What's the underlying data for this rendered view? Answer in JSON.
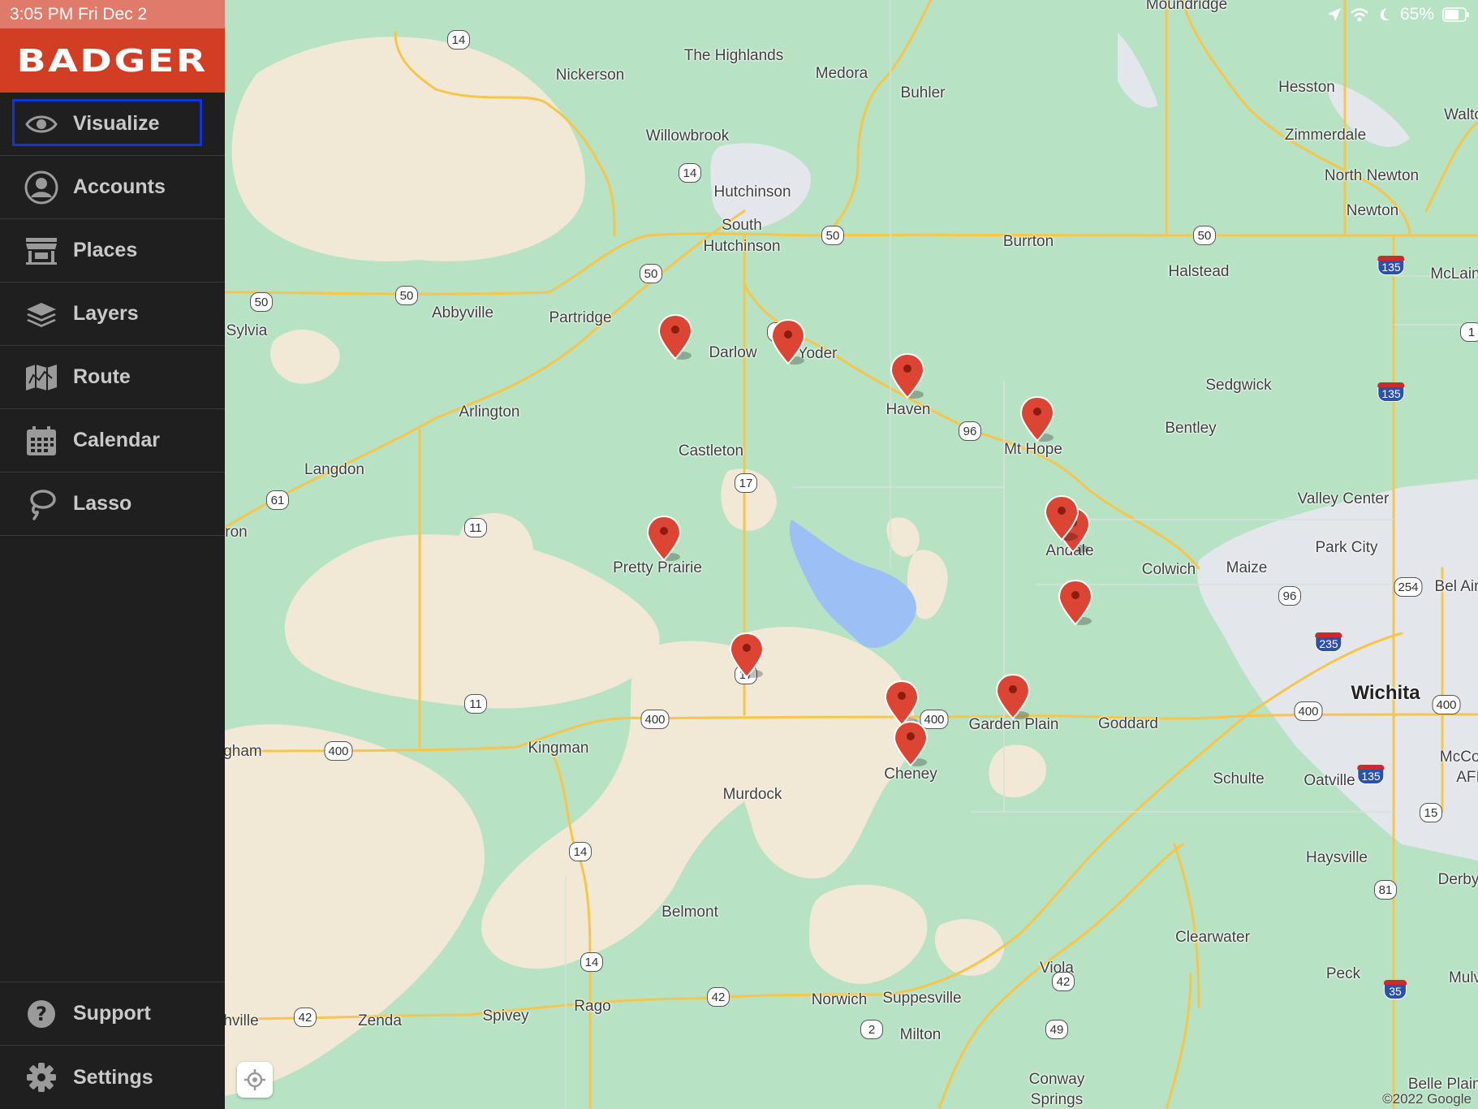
{
  "status": {
    "time_date": "3:05 PM   Fri Dec 2",
    "battery": "65%",
    "icons": [
      "location-arrow-icon",
      "wifi-icon",
      "moon-icon",
      "battery-icon"
    ]
  },
  "brand": {
    "name": "BADGER",
    "color": "#d13e24"
  },
  "nav": {
    "top_items": [
      {
        "label": "Visualize",
        "icon": "eye-icon",
        "selected": true
      },
      {
        "label": "Accounts",
        "icon": "person-circle-icon"
      },
      {
        "label": "Places",
        "icon": "storefront-icon"
      },
      {
        "label": "Layers",
        "icon": "layers-icon"
      },
      {
        "label": "Route",
        "icon": "map-icon"
      },
      {
        "label": "Calendar",
        "icon": "calendar-icon"
      },
      {
        "label": "Lasso",
        "icon": "lasso-icon"
      }
    ],
    "bottom_items": [
      {
        "label": "Support",
        "icon": "question-circle-icon"
      },
      {
        "label": "Settings",
        "icon": "gear-icon"
      }
    ]
  },
  "map": {
    "attribution": "©2022 Google",
    "pin_color": "#dc4533",
    "towns": [
      "Moundridge",
      "The Highlands",
      "Nickerson",
      "Medora",
      "Buhler",
      "Hesston",
      "Walto",
      "Willowbrook",
      "Zimmerdale",
      "Hutchinson",
      "North Newton",
      "Newton",
      "South",
      "Hutchinson",
      "Burrton",
      "Halstead",
      "McLain",
      "Abbyville",
      "Partridge",
      "Sylvia",
      "Darlow",
      "Yoder",
      "Haven",
      "Sedgwick",
      "Arlington",
      "Bentley",
      "Mt Hope",
      "Castleton",
      "Langdon",
      "Valley Center",
      "ron",
      "Andale",
      "Park City",
      "Pretty Prairie",
      "Colwich",
      "Maize",
      "Bel Air",
      "Wichita",
      "Garden Plain",
      "Goddard",
      "gham",
      "Kingman",
      "Cheney",
      "Schulte",
      "Oatville",
      "McCon",
      "AFI",
      "Murdock",
      "Haysville",
      "Derby",
      "Belmont",
      "Clearwater",
      "Viola",
      "Peck",
      "Mulv",
      "hville",
      "Zenda",
      "Spivey",
      "Rago",
      "Norwich",
      "Suppesville",
      "Milton",
      "Conway",
      "Springs",
      "Belle Plaine"
    ],
    "shields": [
      "14",
      "14",
      "50",
      "50",
      "50",
      "50",
      "50",
      "135",
      "96",
      "1",
      "135",
      "96",
      "17",
      "61",
      "11",
      "254",
      "96",
      "235",
      "17",
      "11",
      "400",
      "400",
      "400",
      "400",
      "400",
      "135",
      "14",
      "15",
      "81",
      "14",
      "42",
      "42",
      "42",
      "2",
      "49",
      "35"
    ]
  }
}
